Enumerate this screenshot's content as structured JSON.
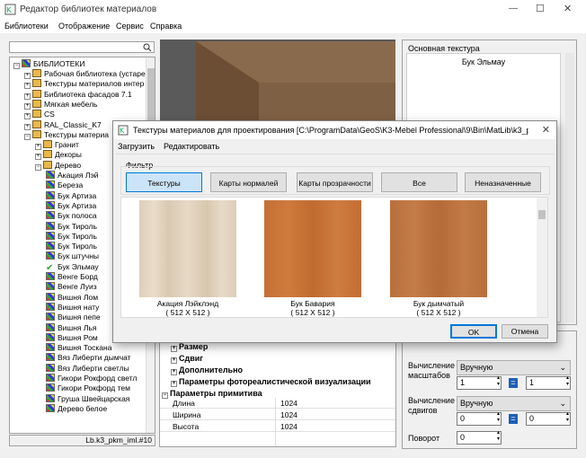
{
  "window": {
    "title": "Редактор библиотек материалов",
    "minimize": "—",
    "maximize": "☐",
    "close": "✕"
  },
  "menu": [
    "Библиотеки",
    "Отображение",
    "Сервис",
    "Справка"
  ],
  "tree": {
    "root": "БИБЛИОТЕКИ",
    "items": [
      "Рабочая библиотека (устаре",
      "Текстуры материалов интер",
      "Библиотека фасадов 7.1",
      "Мягкая мебель",
      "CS",
      "RAL_Classic_K7",
      "Текстуры материа",
      "Гранит",
      "Декоры",
      "Дерево",
      "Акация Лэй",
      "Береза",
      "Бук Артиза",
      "Бук Артиза",
      "Бук полоса",
      "Бук Тироль",
      "Бук Тироль",
      "Бук Тироль",
      "Бук штучны",
      "Бук Эльмау",
      "Венге Борд",
      "Венге Луиз",
      "Вишня Лом",
      "Вишня нату",
      "Вишня пепе",
      "Вишня Лья",
      "Вишня Ром",
      "Вишня Тоскана",
      "Вяз Либерти дымчат",
      "Вяз Либерти светлы",
      "Гикори Рокфорд светл",
      "Гикори Рокфорд тем",
      "Груша Швейцарская",
      "Дерево белое"
    ],
    "status": "Lb.k3_pkm_iml.#10"
  },
  "right_panel": {
    "group_title": "Основная текстура",
    "texture_name": "Бук Эльмау"
  },
  "props": {
    "groups": [
      "Размер",
      "Сдвиг",
      "Дополнительно",
      "Параметры фотореалистической визуализации"
    ],
    "section": "Параметры примитива",
    "rows": [
      {
        "name": "Длина",
        "value": "1024"
      },
      {
        "name": "Ширина",
        "value": "1024"
      },
      {
        "name": "Высота",
        "value": "1024"
      }
    ]
  },
  "scale": {
    "label_scale": "Вычисление масштабов",
    "scale_mode": "Вручную",
    "scale_x": "1",
    "scale_y": "1",
    "label_shift": "Вычисление сдвигов",
    "shift_mode": "Вручную",
    "shift_x": "0",
    "shift_y": "0",
    "label_rotate": "Поворот",
    "rotate": "0",
    "link_symbol": "="
  },
  "dialog": {
    "title": "Текстуры материалов для проектирования [C:\\ProgramData\\GeoS\\K3-Mebel Professional\\9\\Bin\\MatLib\\k3_pkm...",
    "menu": [
      "Загрузить",
      "Редактировать"
    ],
    "filter_label": "Фильтр",
    "filters": [
      "Текстуры",
      "Карты нормалей",
      "Карты прозрачности",
      "Все",
      "Неназначенные"
    ],
    "textures": [
      {
        "name": "Акация Лэйклэнд",
        "size": "( 512 X 512 )"
      },
      {
        "name": "Бук Бавария",
        "size": "( 512 X 512 )"
      },
      {
        "name": "Бук дымчатый",
        "size": "( 512 X 512 )"
      }
    ],
    "ok": "OK",
    "cancel": "Отмена"
  }
}
